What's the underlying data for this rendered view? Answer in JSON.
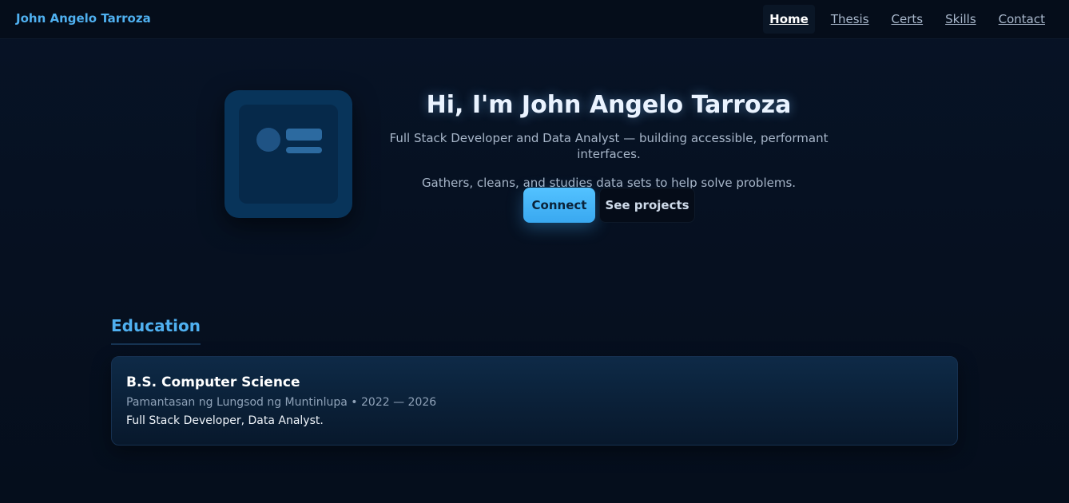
{
  "navbar": {
    "brand": "John Angelo Tarroza",
    "links": [
      {
        "label": "Home",
        "active": true
      },
      {
        "label": "Thesis",
        "active": false
      },
      {
        "label": "Certs",
        "active": false
      },
      {
        "label": "Skills",
        "active": false
      },
      {
        "label": "Contact",
        "active": false
      }
    ]
  },
  "hero": {
    "avatar_icon": "profile-card-icon",
    "title": "Hi, I'm John Angelo Tarroza",
    "subtitle": "Full Stack Developer and Data Analyst — building accessible, performant interfaces.",
    "tagline": "Gathers, cleans, and studies data sets to help solve problems.",
    "primary_button": "Connect",
    "secondary_button": "See projects"
  },
  "education": {
    "heading": "Education",
    "items": [
      {
        "degree": "B.S. Computer Science",
        "meta": "Pamantasan ng Lungsod ng Muntinlupa • 2022 — 2026",
        "description": "Full Stack Developer, Data Analyst."
      }
    ]
  },
  "colors": {
    "accent": "#4fb0f0",
    "background": "#06101f",
    "primary_button": "#47b6fa",
    "card": "#0c2440"
  }
}
